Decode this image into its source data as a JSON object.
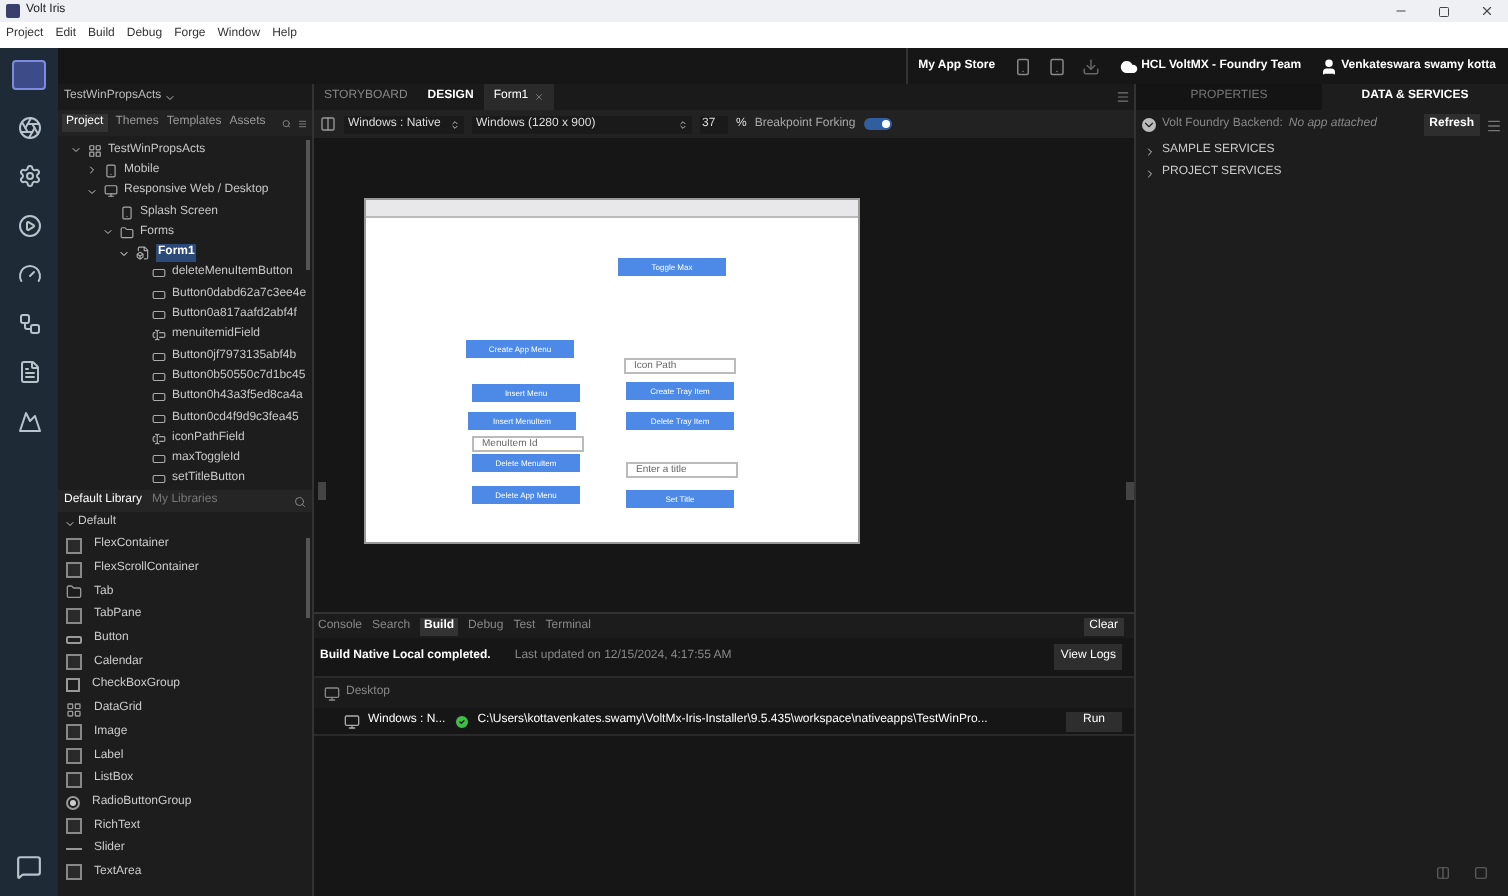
{
  "window": {
    "title": "Volt Iris"
  },
  "menu": [
    "Project",
    "Edit",
    "Build",
    "Debug",
    "Forge",
    "Window",
    "Help"
  ],
  "top_toolbar": {
    "app_store": "My App Store",
    "team": "HCL VoltMX - Foundry Team",
    "user": "Venkateswara swamy kotta"
  },
  "project_panel": {
    "project_name": "TestWinPropsActs",
    "tabs": [
      {
        "label": "Project",
        "selected": true
      },
      {
        "label": "Themes",
        "selected": false
      },
      {
        "label": "Templates",
        "selected": false
      },
      {
        "label": "Assets",
        "selected": false
      }
    ],
    "tree": [
      {
        "label": "TestWinPropsActs",
        "kind": "project",
        "expanded": true,
        "selected": false,
        "children": [
          {
            "label": "Mobile",
            "kind": "device",
            "expanded": false,
            "selected": false
          },
          {
            "label": "Responsive Web / Desktop",
            "kind": "desktop",
            "expanded": true,
            "selected": false,
            "children": [
              {
                "label": "Splash Screen",
                "kind": "device",
                "selected": false
              },
              {
                "label": "Forms",
                "kind": "folder",
                "expanded": true,
                "selected": false,
                "children": [
                  {
                    "label": "Form1",
                    "kind": "form",
                    "expanded": true,
                    "selected": true,
                    "children": [
                      {
                        "label": "deleteMenuItemButton",
                        "kind": "button",
                        "selected": false
                      },
                      {
                        "label": "Button0dabd62a7c3ee4e",
                        "kind": "button",
                        "selected": false
                      },
                      {
                        "label": "Button0a817aafd2abf4f",
                        "kind": "button",
                        "selected": false
                      },
                      {
                        "label": "menuitemidField",
                        "kind": "field",
                        "selected": false
                      },
                      {
                        "label": "Button0jf7973135abf4b",
                        "kind": "button",
                        "selected": false
                      },
                      {
                        "label": "Button0b50550c7d1bc45",
                        "kind": "button",
                        "selected": false
                      },
                      {
                        "label": "Button0h43a3f5ed8ca4a",
                        "kind": "button",
                        "selected": false
                      },
                      {
                        "label": "Button0cd4f9d9c3fea45",
                        "kind": "button",
                        "selected": false
                      },
                      {
                        "label": "iconPathField",
                        "kind": "field",
                        "selected": false
                      },
                      {
                        "label": "maxToggleId",
                        "kind": "button",
                        "selected": false
                      },
                      {
                        "label": "setTitleButton",
                        "kind": "button",
                        "selected": false
                      }
                    ]
                  }
                ]
              }
            ]
          }
        ]
      }
    ]
  },
  "library": {
    "tabs": [
      {
        "label": "Default Library",
        "selected": true
      },
      {
        "label": "My Libraries",
        "selected": false
      }
    ],
    "group": {
      "label": "Default",
      "expanded": true
    },
    "items": [
      {
        "label": "FlexContainer",
        "kind": "flex"
      },
      {
        "label": "FlexScrollContainer",
        "kind": "scroll"
      },
      {
        "label": "Tab",
        "kind": "tab"
      },
      {
        "label": "TabPane",
        "kind": "tabpane"
      },
      {
        "label": "Button",
        "kind": "button"
      },
      {
        "label": "Calendar",
        "kind": "calendar"
      },
      {
        "label": "CheckBoxGroup",
        "kind": "checkbox"
      },
      {
        "label": "DataGrid",
        "kind": "grid"
      },
      {
        "label": "Image",
        "kind": "image"
      },
      {
        "label": "Label",
        "kind": "label"
      },
      {
        "label": "ListBox",
        "kind": "listbox"
      },
      {
        "label": "RadioButtonGroup",
        "kind": "radio"
      },
      {
        "label": "RichText",
        "kind": "richtext"
      },
      {
        "label": "Slider",
        "kind": "slider"
      },
      {
        "label": "TextArea",
        "kind": "textarea"
      }
    ]
  },
  "editor_tabs": [
    {
      "label": "STORYBOARD",
      "selected": false,
      "kind": "view"
    },
    {
      "label": "DESIGN",
      "selected": true,
      "kind": "view"
    },
    {
      "label": "Form1",
      "selected": false,
      "kind": "file"
    }
  ],
  "design_toolbar": {
    "platform": "Windows : Native",
    "resolution": "Windows (1280 x 900)",
    "zoom": "37",
    "percent": "%",
    "breakpoint_label": "Breakpoint Forking",
    "breakpoint_on": true
  },
  "canvas": {
    "widgets": [
      {
        "kind": "button",
        "label": "Toggle Max"
      },
      {
        "kind": "button",
        "label": "Create App Menu"
      },
      {
        "kind": "field",
        "placeholder": "Icon Path"
      },
      {
        "kind": "button",
        "label": "Insert Menu"
      },
      {
        "kind": "button",
        "label": "Create Tray Item"
      },
      {
        "kind": "button",
        "label": "Insert MenuItem"
      },
      {
        "kind": "button",
        "label": "Delete Tray Item"
      },
      {
        "kind": "field",
        "placeholder": "MenuItem Id"
      },
      {
        "kind": "button",
        "label": "Delete MenuItem"
      },
      {
        "kind": "field",
        "placeholder": "Enter a title"
      },
      {
        "kind": "button",
        "label": "Delete App Menu"
      },
      {
        "kind": "button",
        "label": "Set Title"
      }
    ]
  },
  "bottom_panel": {
    "tabs": [
      {
        "label": "Console",
        "selected": false
      },
      {
        "label": "Search",
        "selected": false
      },
      {
        "label": "Build",
        "selected": true
      },
      {
        "label": "Debug",
        "selected": false
      },
      {
        "label": "Test",
        "selected": false
      },
      {
        "label": "Terminal",
        "selected": false
      }
    ],
    "clear": "Clear",
    "status": "Build Native Local completed.",
    "updated": "Last updated on 12/15/2024, 4:17:55 AM",
    "view_logs": "View Logs",
    "group": "Desktop",
    "builds": [
      {
        "platform": "Windows : N...",
        "success": true,
        "path": "C:\\Users\\kottavenkates.swamy\\VoltMx-Iris-Installer\\9.5.435\\workspace\\nativeapps\\TestWinPro...",
        "action": "Run"
      }
    ]
  },
  "right_panel": {
    "tabs": [
      {
        "label": "PROPERTIES",
        "selected": false
      },
      {
        "label": "DATA & SERVICES",
        "selected": true
      }
    ],
    "backend_label": "Volt Foundry Backend:",
    "backend_value": "No app attached",
    "refresh": "Refresh",
    "sections": [
      {
        "label": "SAMPLE SERVICES",
        "expanded": false
      },
      {
        "label": "PROJECT SERVICES",
        "expanded": false
      }
    ]
  }
}
